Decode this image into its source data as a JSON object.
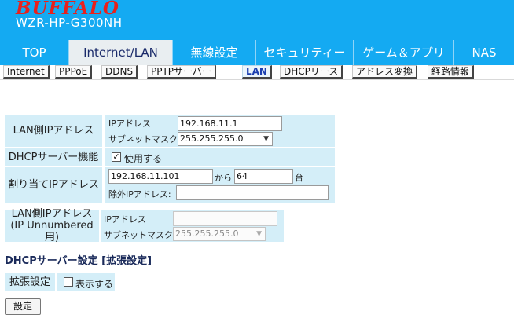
{
  "header": {
    "brand": "BUFFALO",
    "model": "WZR-HP-G300NH"
  },
  "main_nav": {
    "tabs": [
      {
        "label": "TOP"
      },
      {
        "label": "Internet/LAN",
        "active": true
      },
      {
        "label": "無線設定"
      },
      {
        "label": "セキュリティー"
      },
      {
        "label": "ゲーム＆アプリ"
      },
      {
        "label": "NAS"
      }
    ]
  },
  "sub_nav": {
    "tabs": [
      {
        "label": "Internet"
      },
      {
        "label": "PPPoE"
      },
      {
        "label": "DDNS"
      },
      {
        "label": "PPTPサーバー"
      },
      {
        "label": "LAN",
        "active": true
      },
      {
        "label": "DHCPリース"
      },
      {
        "label": "アドレス変換"
      },
      {
        "label": "経路情報"
      }
    ]
  },
  "lan_ip": {
    "label": "LAN側IPアドレス",
    "ip_label": "IPアドレス",
    "ip_value": "192.168.11.1",
    "mask_label": "サブネットマスク",
    "mask_value": "255.255.255.0"
  },
  "dhcp_server": {
    "label": "DHCPサーバー機能",
    "use_label": "使用する",
    "use_checked": true
  },
  "assign_ip": {
    "label": "割り当てIPアドレス",
    "start_value": "192.168.11.101",
    "from_label": "から",
    "count_value": "64",
    "unit_label": "台",
    "exclude_label": "除外IPアドレス:",
    "exclude_value": ""
  },
  "unnumbered": {
    "label_line1": "LAN側IPアドレス",
    "label_line2": "(IP Unnumbered用)",
    "ip_label": "IPアドレス",
    "ip_value": "",
    "mask_label": "サブネットマスク",
    "mask_value": "255.255.255.0"
  },
  "dhcp_extended": {
    "title": "DHCPサーバー設定 [拡張設定]",
    "label": "拡張設定",
    "show_label": "表示する",
    "show_checked": false
  },
  "submit_label": "設定",
  "colors": {
    "nav_blue": "#14aaf2",
    "form_bg": "#d4eef8",
    "brand_red": "#e8211c"
  }
}
